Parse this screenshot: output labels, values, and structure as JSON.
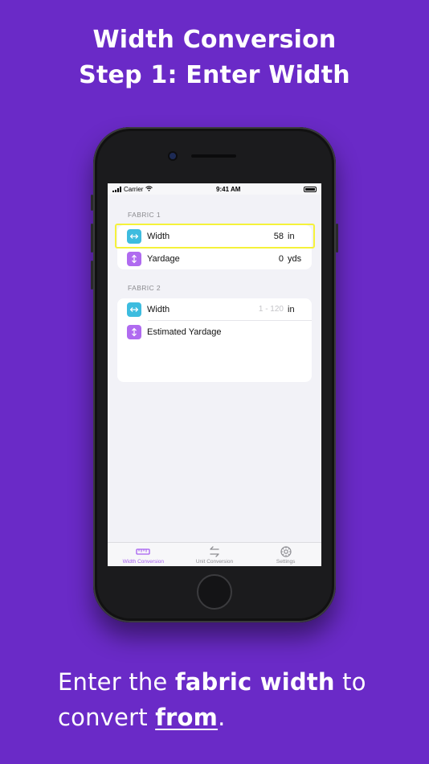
{
  "headline": {
    "line1": "Width Conversion",
    "line2": "Step 1: Enter Width"
  },
  "status_bar": {
    "carrier": "Carrier",
    "time": "9:41 AM"
  },
  "fabric1": {
    "section_label": "FABRIC 1",
    "width": {
      "label": "Width",
      "value": "58",
      "unit": "in",
      "icon": "horizontal-arrows-icon"
    },
    "yardage": {
      "label": "Yardage",
      "value": "0",
      "unit": "yds",
      "icon": "vertical-arrows-icon"
    }
  },
  "fabric2": {
    "section_label": "FABRIC 2",
    "width": {
      "label": "Width",
      "placeholder": "1 - 120",
      "unit": "in",
      "icon": "horizontal-arrows-icon"
    },
    "estimated_yardage": {
      "label": "Estimated Yardage",
      "icon": "vertical-arrows-icon"
    }
  },
  "tabs": [
    {
      "label": "Width Conversion",
      "icon": "ruler-icon",
      "active": true
    },
    {
      "label": "Unit Conversion",
      "icon": "swap-arrows-icon",
      "active": false
    },
    {
      "label": "Settings",
      "icon": "gear-icon",
      "active": false
    }
  ],
  "caption": {
    "part1": "Enter the ",
    "bold": "fabric width",
    "part2": " to convert ",
    "emph": "from",
    "part3": "."
  },
  "colors": {
    "background": "#6a2ac7",
    "accent": "#a55ef0",
    "teal_icon": "#3dbcdf",
    "purple_icon": "#b06bf0",
    "highlight": "#f5f23a"
  }
}
